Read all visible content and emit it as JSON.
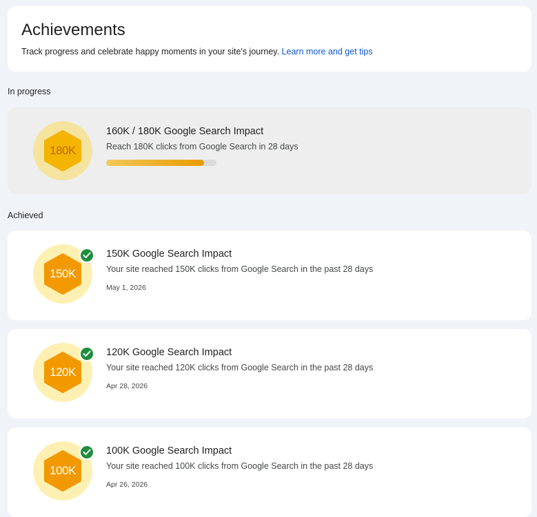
{
  "header": {
    "title": "Achievements",
    "subtitle": "Track progress and celebrate happy moments in your site's journey.",
    "link_text": "Learn more and get tips"
  },
  "sections": {
    "in_progress_label": "In progress",
    "achieved_label": "Achieved"
  },
  "in_progress": {
    "badge": "180K",
    "title": "160K / 180K Google Search Impact",
    "description": "Reach 180K clicks from Google Search in 28 days",
    "progress_fraction": 0.889
  },
  "achieved": [
    {
      "badge": "150K",
      "title": "150K Google Search Impact",
      "description": "Your site reached 150K clicks from Google Search in the past 28 days",
      "date": "May 1, 2026"
    },
    {
      "badge": "120K",
      "title": "120K Google Search Impact",
      "description": "Your site reached 120K clicks from Google Search in the past 28 days",
      "date": "Apr 28, 2026"
    },
    {
      "badge": "100K",
      "title": "100K Google Search Impact",
      "description": "Your site reached 100K clicks from Google Search in the past 28 days",
      "date": "Apr 26, 2026"
    }
  ],
  "colors": {
    "in_progress_hex": "#f4b400",
    "achieved_hex": "#f29900",
    "check": "#1e8e3e",
    "link": "#0b57d0"
  },
  "icons": {
    "achievement_badge": "hexagon-badge-icon",
    "achieved_check": "check-circle-icon"
  }
}
